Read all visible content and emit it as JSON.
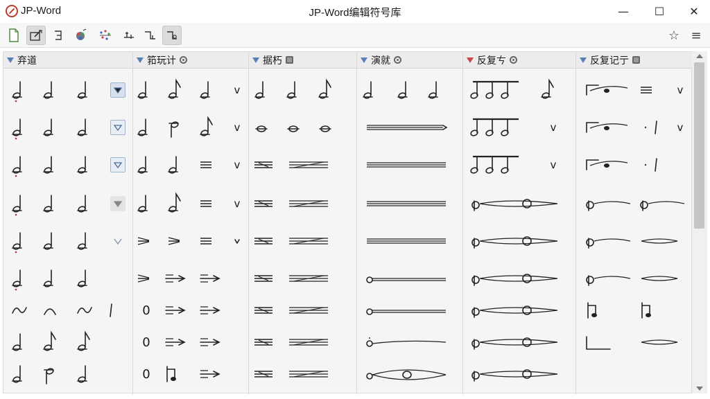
{
  "app": {
    "name": "JP-Word",
    "window_title": "JP-Word编辑符号库"
  },
  "window_controls": {
    "minimize": "—",
    "maximize": "☐",
    "close": "✕"
  },
  "toolbar": {
    "icons": [
      "new-document-icon",
      "edit-icon",
      "bracket-icon",
      "color-icon",
      "scatter-icon",
      "tie-icon",
      "slur-icon",
      "beam-icon"
    ],
    "right_icons": [
      "star-icon",
      "menu-icon"
    ],
    "star": "☆",
    "menu": "≡"
  },
  "columns": [
    {
      "title": "弃道",
      "triangle_color": "#5a7fb5",
      "badge": "none"
    },
    {
      "title": "筘玩计",
      "triangle_color": "#5a7fb5",
      "badge": "circle"
    },
    {
      "title": "据朽",
      "triangle_color": "#5a7fb5",
      "badge": "square"
    },
    {
      "title": "演就",
      "triangle_color": "#5a7fb5",
      "badge": "circle"
    },
    {
      "title": "反复ㄘ",
      "triangle_color": "#c94a4a",
      "badge": "circle"
    },
    {
      "title": "反复记亍",
      "triangle_color": "#5a7fb5",
      "badge": "square"
    }
  ],
  "zero_label": "0",
  "v_label": "v"
}
